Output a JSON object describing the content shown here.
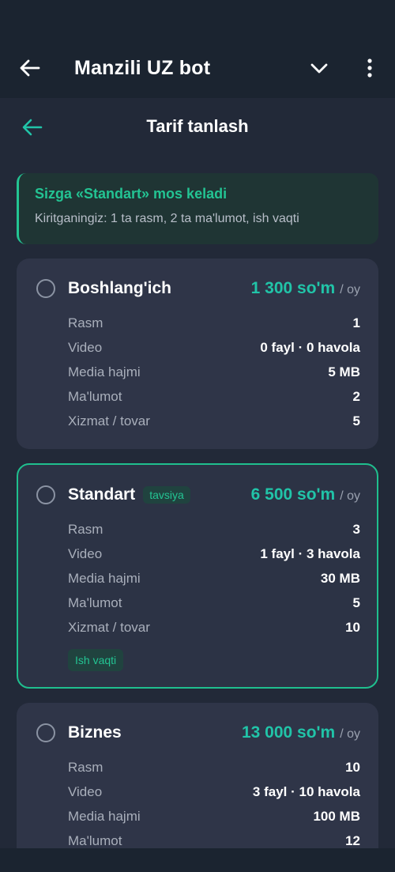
{
  "header": {
    "title": "Manzili UZ bot"
  },
  "page": {
    "title": "Tarif tanlash"
  },
  "suggestion": {
    "title": "Sizga «Standart» mos keladi",
    "subtitle": "Kiritganingiz: 1 ta rasm, 2 ta ma'lumot, ish vaqti"
  },
  "plans": [
    {
      "name": "Boshlang'ich",
      "price": "1 300 so'm",
      "per": "/ oy",
      "rows": [
        {
          "k": "Rasm",
          "v": "1"
        },
        {
          "k": "Video",
          "v": "0 fayl · 0 havola"
        },
        {
          "k": "Media hajmi",
          "v": "5 MB"
        },
        {
          "k": "Ma'lumot",
          "v": "2"
        },
        {
          "k": "Xizmat / tovar",
          "v": "5"
        }
      ]
    },
    {
      "name": "Standart",
      "tag": "tavsiya",
      "price": "6 500 so'm",
      "per": "/ oy",
      "rows": [
        {
          "k": "Rasm",
          "v": "3"
        },
        {
          "k": "Video",
          "v": "1 fayl · 3 havola"
        },
        {
          "k": "Media hajmi",
          "v": "30 MB"
        },
        {
          "k": "Ma'lumot",
          "v": "5"
        },
        {
          "k": "Xizmat / tovar",
          "v": "10"
        }
      ],
      "chip": "Ish vaqti"
    },
    {
      "name": "Biznes",
      "price": "13 000 so'm",
      "per": "/ oy",
      "rows": [
        {
          "k": "Rasm",
          "v": "10"
        },
        {
          "k": "Video",
          "v": "3 fayl · 10 havola"
        },
        {
          "k": "Media hajmi",
          "v": "100 MB"
        },
        {
          "k": "Ma'lumot",
          "v": "12"
        }
      ]
    }
  ],
  "colors": {
    "accent": "#23c493",
    "price": "#21c4a8",
    "background": "#1b2430",
    "card": "#2f3548"
  },
  "icons": {
    "back": "arrow-left-icon",
    "expand": "chevron-down-icon",
    "menu": "more-vertical-icon"
  }
}
